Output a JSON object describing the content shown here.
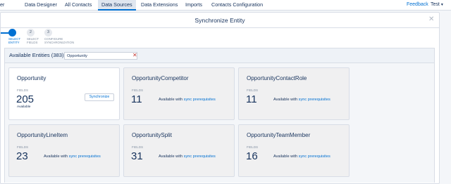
{
  "nav": {
    "tabs": [
      {
        "label": "er"
      },
      {
        "label": "Data Designer"
      },
      {
        "label": "All Contacts"
      },
      {
        "label": "Data Sources"
      },
      {
        "label": "Data Extensions"
      },
      {
        "label": "Imports"
      },
      {
        "label": "Contacts Configuration"
      }
    ],
    "active_tab": "Data Sources",
    "feedback": "Feedback",
    "user": "Test"
  },
  "modal": {
    "title": "Synchronize Entity",
    "close_icon": "close-icon",
    "steps": [
      {
        "number": "1",
        "label_line1": "SELECT",
        "label_line2": "ENTITY"
      },
      {
        "number": "2",
        "label_line1": "SELECT",
        "label_line2": "FIELDS"
      },
      {
        "number": "3",
        "label_line1": "CONFIGURE",
        "label_line2": "SYNCHRONIZATION"
      }
    ],
    "current_step": 1
  },
  "filter": {
    "label": "Available Entities (383)",
    "search_value": "Opportunity",
    "clear_icon": "clear-x-icon"
  },
  "cards": [
    {
      "name": "Opportunity",
      "fields_label": "FIELDS",
      "count": "205",
      "status": "Available",
      "button": "Synchronize"
    },
    {
      "name": "OpportunityCompetitor",
      "fields_label": "FIELDS",
      "count": "11",
      "note_prefix": "Available with",
      "note_link": "sync prerequisites"
    },
    {
      "name": "OpportunityContactRole",
      "fields_label": "FIELDS",
      "count": "11",
      "note_prefix": "Available with",
      "note_link": "sync prerequisites"
    },
    {
      "name": "OpportunityLineItem",
      "fields_label": "FIELDS",
      "count": "23",
      "note_prefix": "Available with",
      "note_link": "sync prerequisites"
    },
    {
      "name": "OpportunitySplit",
      "fields_label": "FIELDS",
      "count": "31",
      "note_prefix": "Available with",
      "note_link": "sync prerequisites"
    },
    {
      "name": "OpportunityTeamMember",
      "fields_label": "FIELDS",
      "count": "16",
      "note_prefix": "Available with",
      "note_link": "sync prerequisites"
    }
  ],
  "colors": {
    "accent": "#0070d2",
    "text": "#16325c",
    "clear": "#c23934"
  }
}
